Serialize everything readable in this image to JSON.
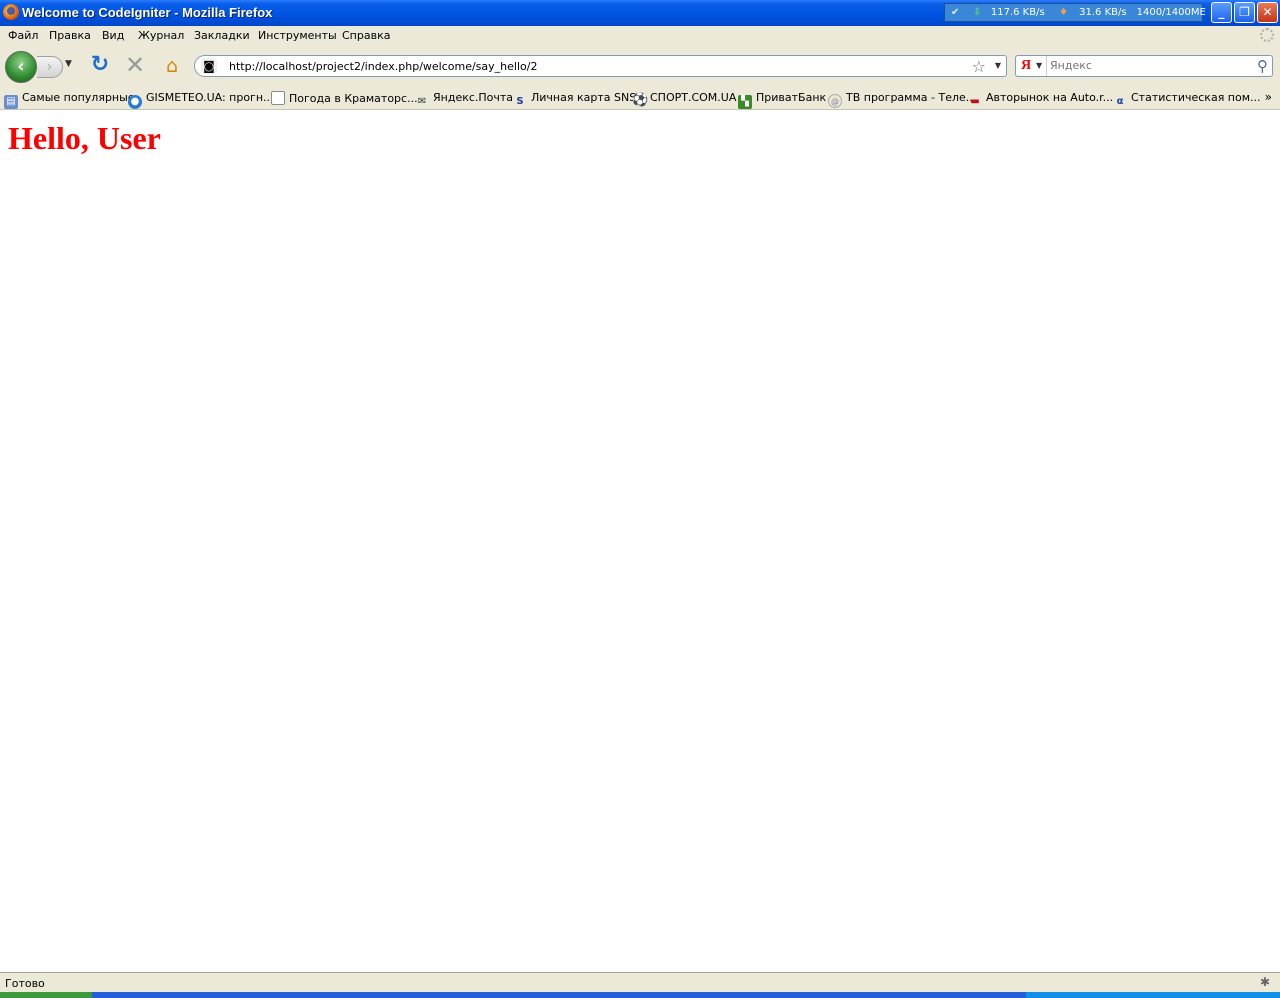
{
  "window": {
    "title": "Welcome to CodeIgniter - Mozilla Firefox",
    "netmon": {
      "download": "117.6 KB/s",
      "upload": "31.6 KB/s",
      "traffic": "1400/1400ME"
    }
  },
  "menu": [
    "Файл",
    "Правка",
    "Вид",
    "Журнал",
    "Закладки",
    "Инструменты",
    "Справка"
  ],
  "navigation": {
    "url": "http://localhost/project2/index.php/welcome/say_hello/2",
    "search_placeholder": "Яндекс",
    "search_engine_logo": "Я"
  },
  "bookmarks": [
    "Самые популярные",
    "GISMETEO.UA: прогн...",
    "Погода в Краматорс...",
    "Яндекс.Почта",
    "Личная карта SNS",
    "СПОРТ.COM.UA",
    "ПриватБанк",
    "ТВ программа - Теле...",
    "Авторынок на Auto.r...",
    "Статистическая пом..."
  ],
  "page": {
    "heading": "Hello, User"
  },
  "status": {
    "text": "Готово"
  },
  "colors": {
    "heading": "#ff0000",
    "titlebar": "#0054e3",
    "chrome": "#ece9d8"
  }
}
